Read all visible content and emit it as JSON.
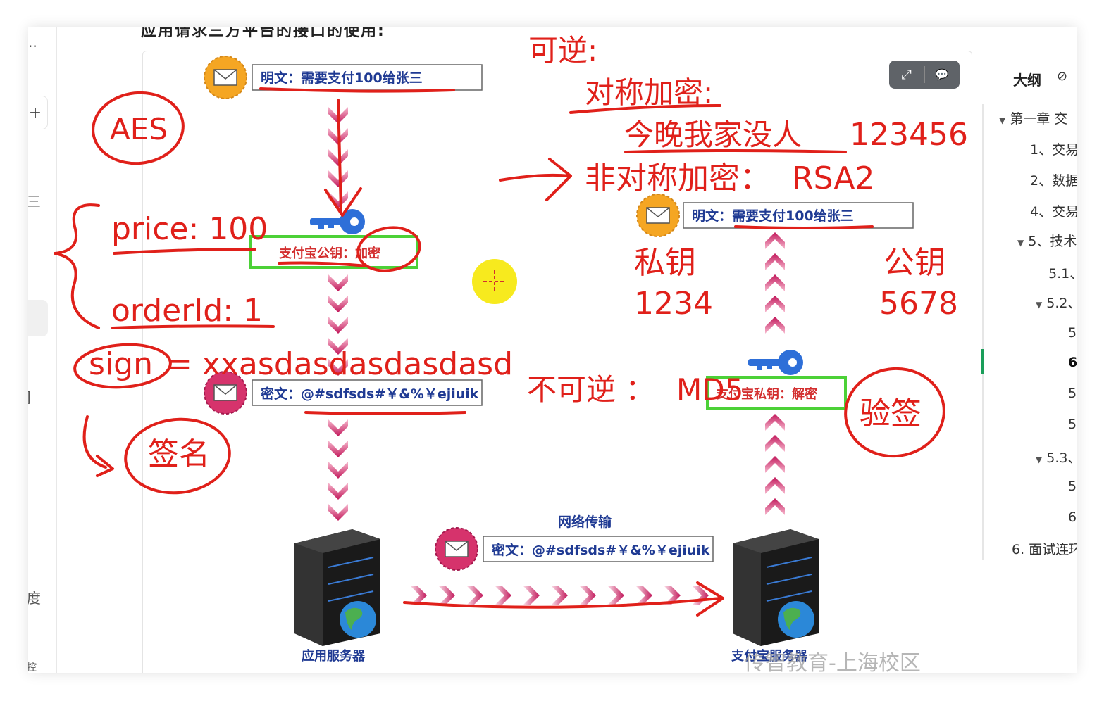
{
  "doc": {
    "cut_title": "应用请求三方平台的接口的使用:"
  },
  "left_rail": {
    "dots": "..",
    "plus": "+",
    "menu_glyph": "三",
    "bracket_glyph": "]",
    "char_du": "度",
    "char_bottom": "控"
  },
  "toolbar": {
    "expand_icon": "⤢",
    "comment_icon": "💬"
  },
  "outline": {
    "title": "大纲",
    "items": [
      {
        "label": "第一章 交",
        "caret": "▼"
      },
      {
        "label": "1、交易"
      },
      {
        "label": "2、数据"
      },
      {
        "label": "4、交易"
      },
      {
        "label": "5、技术",
        "caret": "▼"
      },
      {
        "label": "5.1、"
      },
      {
        "label": "5.2、",
        "caret": "▼"
      },
      {
        "label": "5."
      },
      {
        "label": "6"
      },
      {
        "label": "5."
      },
      {
        "label": "5."
      },
      {
        "label": "5.3、",
        "caret": "▼"
      },
      {
        "label": "5."
      },
      {
        "label": "6."
      },
      {
        "label": "6. 面试连环"
      }
    ]
  },
  "diagram": {
    "plain_text_left": "明文：需要支付100给张三",
    "plain_text_right": "明文：需要支付100给张三",
    "public_key_label": "支付宝公钥：加密",
    "private_key_label": "支付宝私钥：解密",
    "cipher_left": "密文：@#sdfsds#￥&%￥ejiuik",
    "cipher_network": "密文：@#sdfsds#￥&%￥ejiuik",
    "network_label": "网络传输",
    "app_server_label": "应用服务器",
    "alipay_server_label": "支付宝服务器",
    "watermark": "传智教育-上海校区"
  },
  "annotations": {
    "reversible": "可逆:",
    "symmetric": "对称加密:",
    "tonight": "今晚我家没人",
    "num_123456": "123456",
    "asymmetric": "非对称加密：",
    "rsa2": "RSA2",
    "private_key": "私钥",
    "private_num": "1234",
    "public_key": "公钥",
    "public_num": "5678",
    "aes": "AES",
    "price": "price: 100",
    "orderid": "orderId: 1",
    "sign_word": "sign",
    "sign_rest": "= xxasdasdasdasdasd",
    "signature": "签名",
    "irreversible": "不可逆 ：",
    "md5": "MD5",
    "verify": "验签"
  },
  "colors": {
    "ink": "#e0201a",
    "arrow_dark": "#c2185b",
    "arrow_light": "#f48fb1",
    "box_green": "#4cd137",
    "envelope_orange": "#f5a623",
    "envelope_pink": "#d6336c"
  }
}
